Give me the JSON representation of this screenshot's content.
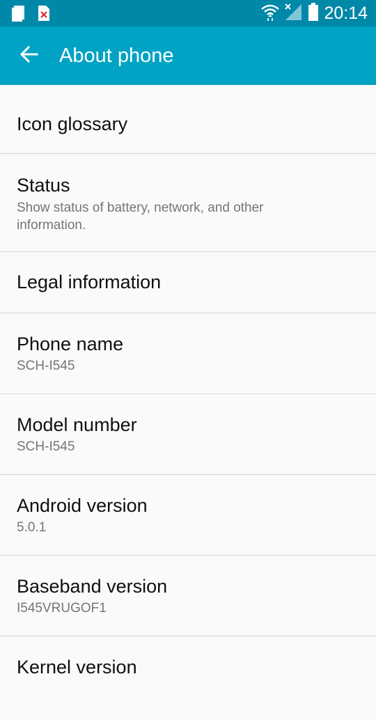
{
  "status_bar": {
    "time": "20:14",
    "icons": [
      "notification-card-icon",
      "notification-error-icon",
      "wifi-icon",
      "no-signal-icon",
      "battery-icon"
    ]
  },
  "app_bar": {
    "title": "About phone",
    "back_icon": "arrow-left-icon"
  },
  "items": [
    {
      "title": "Icon glossary"
    },
    {
      "title": "Status",
      "subtitle": "Show status of battery, network, and other information."
    },
    {
      "title": "Legal information"
    },
    {
      "title": "Phone name",
      "subtitle": "SCH-I545"
    },
    {
      "title": "Model number",
      "subtitle": "SCH-I545"
    },
    {
      "title": "Android version",
      "subtitle": "5.0.1"
    },
    {
      "title": "Baseband version",
      "subtitle": "I545VRUGOF1"
    },
    {
      "title": "Kernel version"
    }
  ],
  "colors": {
    "status_bar": "#0088a8",
    "app_bar": "#00a3c3",
    "background": "#fafafa",
    "divider": "#d6d6d6"
  }
}
